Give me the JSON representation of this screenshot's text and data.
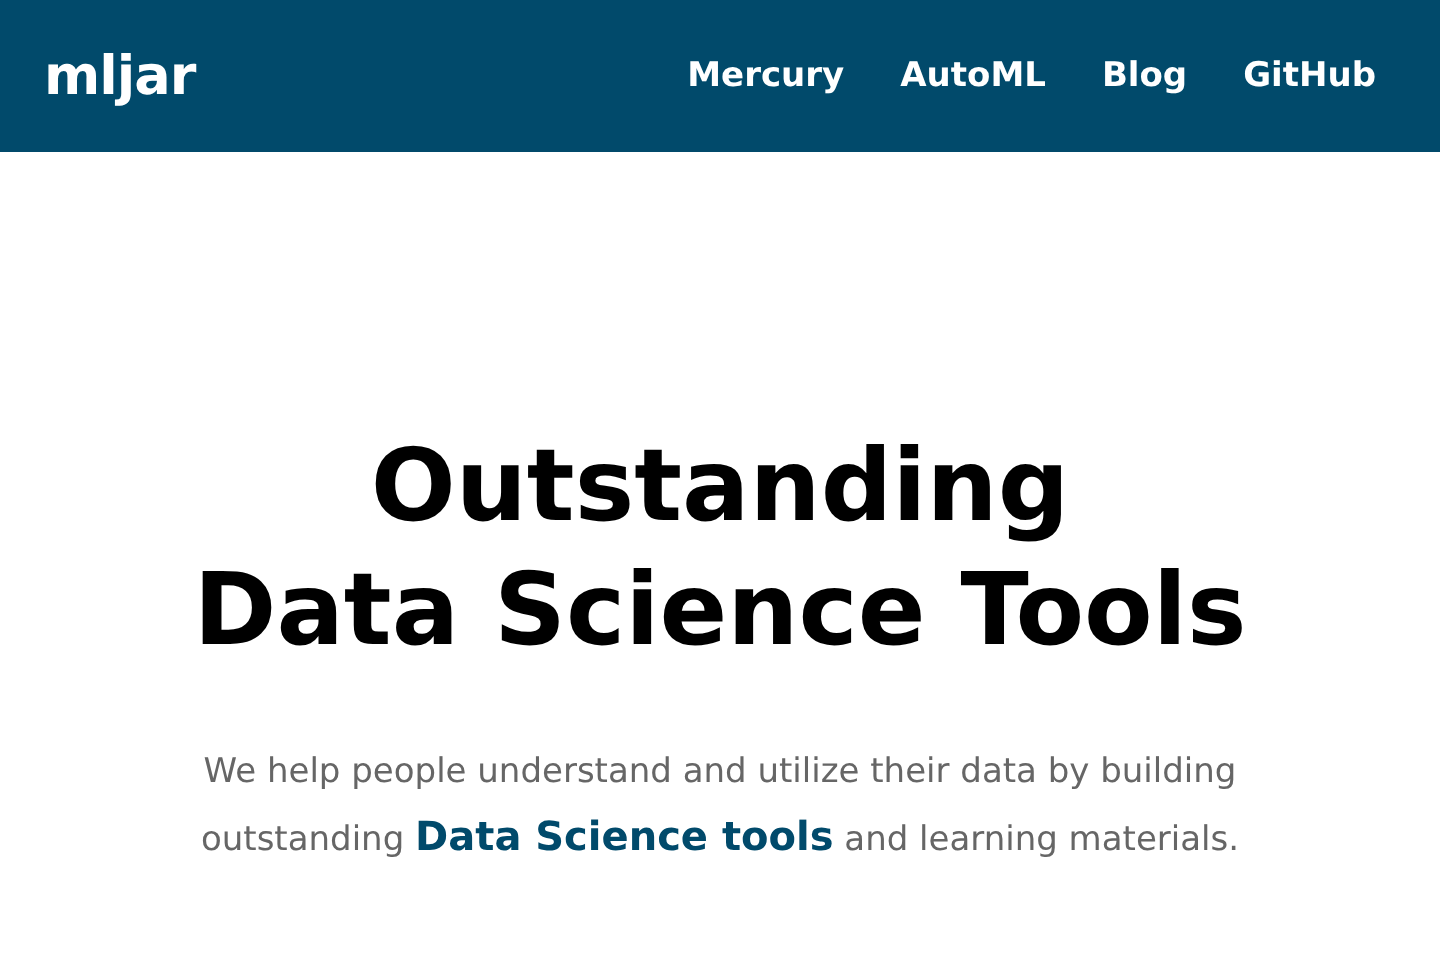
{
  "header": {
    "logo": "mljar",
    "nav": [
      "Mercury",
      "AutoML",
      "Blog",
      "GitHub"
    ]
  },
  "hero": {
    "title_lines": [
      "Outstanding",
      "Data Science Tools"
    ],
    "lead": "We help people understand and utilize their data by building outstanding **Data Science tools** and learning materials."
  }
}
